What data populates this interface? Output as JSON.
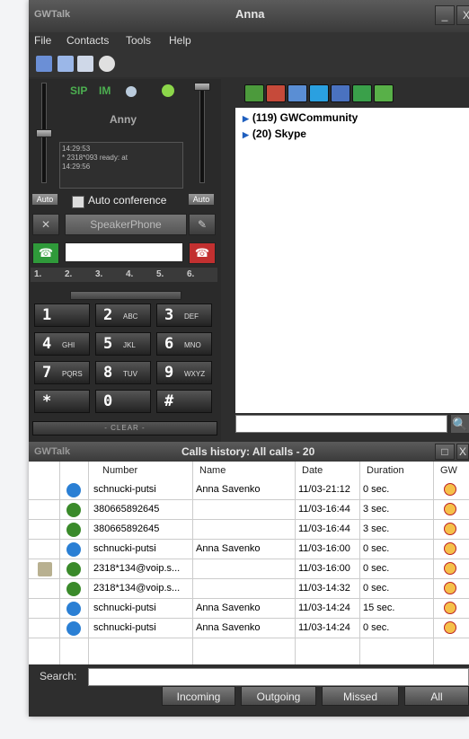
{
  "window": {
    "app_name": "GWTalk",
    "title": "Anna",
    "minimize": "_",
    "close": "X"
  },
  "menu": [
    "File",
    "Contacts",
    "Tools",
    "Help"
  ],
  "status": {
    "sip": "SIP",
    "im": "IM",
    "user": "Anny"
  },
  "log": [
    "14:29:53",
    "* 2318*093 ready: at",
    "14:29:56"
  ],
  "controls": {
    "auto_left": "Auto",
    "auto_right": "Auto",
    "auto_conference": "Auto conference",
    "speakerphone": "SpeakerPhone"
  },
  "lines": [
    "1.",
    "2.",
    "3.",
    "4.",
    "5.",
    "6."
  ],
  "keypad": [
    {
      "digit": "1",
      "letters": ""
    },
    {
      "digit": "2",
      "letters": "ABC"
    },
    {
      "digit": "3",
      "letters": "DEF"
    },
    {
      "digit": "4",
      "letters": "GHI"
    },
    {
      "digit": "5",
      "letters": "JKL"
    },
    {
      "digit": "6",
      "letters": "MNO"
    },
    {
      "digit": "7",
      "letters": "PQRS"
    },
    {
      "digit": "8",
      "letters": "TUV"
    },
    {
      "digit": "9",
      "letters": "WXYZ"
    },
    {
      "digit": "*",
      "letters": ""
    },
    {
      "digit": "0",
      "letters": ""
    },
    {
      "digit": "#",
      "letters": ""
    }
  ],
  "clear": "- CLEAR -",
  "contacts": [
    {
      "count": "(119)",
      "name": "GWCommunity"
    },
    {
      "count": "(20)",
      "name": "Skype"
    }
  ],
  "history": {
    "app_name": "GWTalk",
    "title": "Calls history: All calls - 20",
    "columns": {
      "number": "Number",
      "name": "Name",
      "date": "Date",
      "duration": "Duration",
      "gw": "GW"
    },
    "rows": [
      {
        "type": "skype",
        "note": false,
        "number": "schnucki-putsi",
        "name": "Anna Savenko",
        "date": "11/03-21:12",
        "duration": "0 sec."
      },
      {
        "type": "phone",
        "note": false,
        "number": "380665892645",
        "name": "",
        "date": "11/03-16:44",
        "duration": "3 sec."
      },
      {
        "type": "phone",
        "note": false,
        "number": "380665892645",
        "name": "",
        "date": "11/03-16:44",
        "duration": "3 sec."
      },
      {
        "type": "skype",
        "note": false,
        "number": "schnucki-putsi",
        "name": "Anna Savenko",
        "date": "11/03-16:00",
        "duration": "0 sec."
      },
      {
        "type": "phone",
        "note": true,
        "number": "2318*134@voip.s...",
        "name": "",
        "date": "11/03-16:00",
        "duration": "0 sec."
      },
      {
        "type": "phone",
        "note": false,
        "number": "2318*134@voip.s...",
        "name": "",
        "date": "11/03-14:32",
        "duration": "0 sec."
      },
      {
        "type": "skype",
        "note": false,
        "number": "schnucki-putsi",
        "name": "Anna Savenko",
        "date": "11/03-14:24",
        "duration": "15 sec."
      },
      {
        "type": "skype",
        "note": false,
        "number": "schnucki-putsi",
        "name": "Anna Savenko",
        "date": "11/03-14:24",
        "duration": "0 sec."
      }
    ],
    "search_label": "Search:",
    "filters": [
      "Incoming",
      "Outgoing",
      "Missed",
      "All"
    ]
  },
  "colors": {
    "skype": "#2a7fd4",
    "phone": "#3a8a2a",
    "accent_green": "#4caf50"
  }
}
